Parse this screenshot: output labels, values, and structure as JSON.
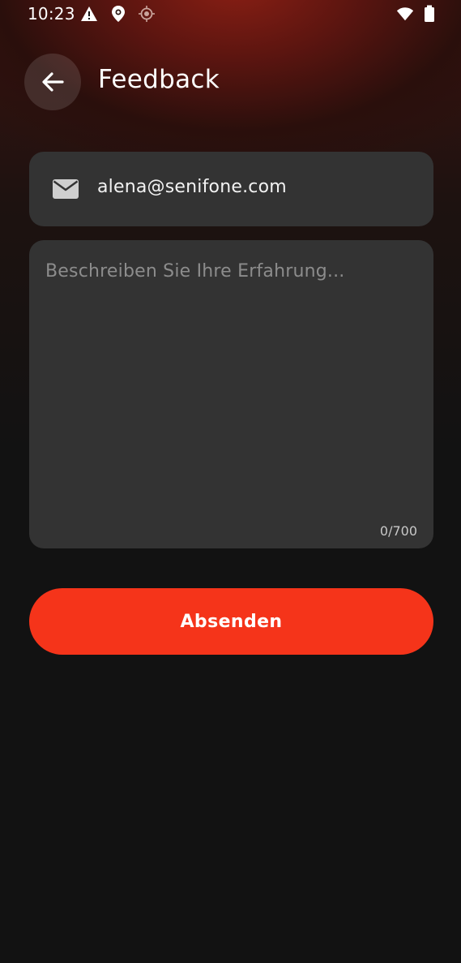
{
  "status_bar": {
    "time": "10:23",
    "icons": [
      "warning-icon",
      "location-pin-icon",
      "gps-icon",
      "wifi-icon",
      "battery-icon"
    ]
  },
  "header": {
    "back_icon": "arrow-left-icon",
    "title": "Feedback"
  },
  "form": {
    "email": {
      "icon": "mail-icon",
      "value": "alena@senifone.com"
    },
    "feedback": {
      "placeholder": "Beschreiben Sie Ihre Erfahrung...",
      "counter": "0/700"
    },
    "submit_label": "Absenden"
  },
  "colors": {
    "accent": "#f5341a",
    "field_background": "#333333",
    "page_background": "#121212"
  }
}
